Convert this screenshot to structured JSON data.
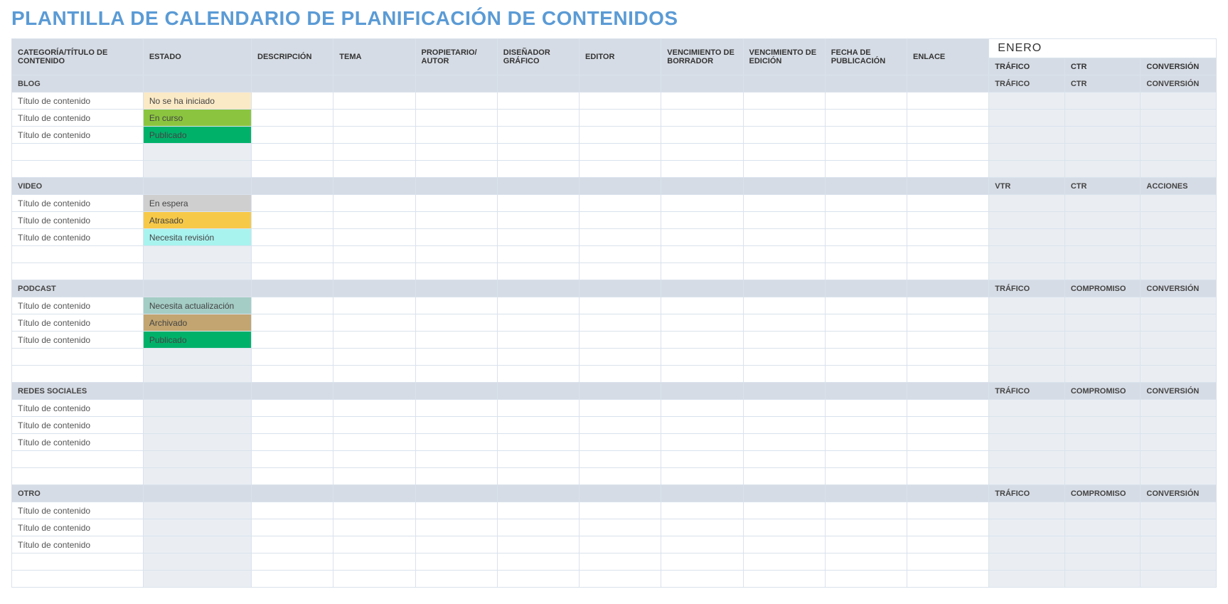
{
  "title": "PLANTILLA DE CALENDARIO DE PLANIFICACIÓN DE CONTENIDOS",
  "month": "ENERO",
  "headers": {
    "categoria": "CATEGORÍA/TÍTULO DE CONTENIDO",
    "estado": "ESTADO",
    "descripcion": "DESCRIPCIÓN",
    "tema": "TEMA",
    "propietario": "PROPIETARIO/ AUTOR",
    "disenador": "DISEÑADOR GRÁFICO",
    "editor": "EDITOR",
    "venc_borrador": "VENCIMIENTO DE BORRADOR",
    "venc_edicion": "VENCIMIENTO DE EDICIÓN",
    "fecha_pub": "FECHA DE PUBLICACIÓN",
    "enlace": "ENLACE"
  },
  "status_labels": {
    "no_iniciado": "No se ha iniciado",
    "en_curso": "En curso",
    "publicado": "Publicado",
    "en_espera": "En espera",
    "atrasado": "Atrasado",
    "revision": "Necesita revisión",
    "actualizacion": "Necesita actualización",
    "archivado": "Archivado"
  },
  "row_title_placeholder": "Título de contenido",
  "sections": {
    "blog": {
      "label": "BLOG",
      "metrics": [
        "TRÁFICO",
        "CTR",
        "CONVERSIÓN"
      ]
    },
    "video": {
      "label": "VIDEO",
      "metrics": [
        "VTR",
        "CTR",
        "ACCIONES"
      ]
    },
    "podcast": {
      "label": "PODCAST",
      "metrics": [
        "TRÁFICO",
        "COMPROMISO",
        "CONVERSIÓN"
      ]
    },
    "redes": {
      "label": "REDES SOCIALES",
      "metrics": [
        "TRÁFICO",
        "COMPROMISO",
        "CONVERSIÓN"
      ]
    },
    "otro": {
      "label": "OTRO",
      "metrics": [
        "TRÁFICO",
        "COMPROMISO",
        "CONVERSIÓN"
      ]
    }
  }
}
